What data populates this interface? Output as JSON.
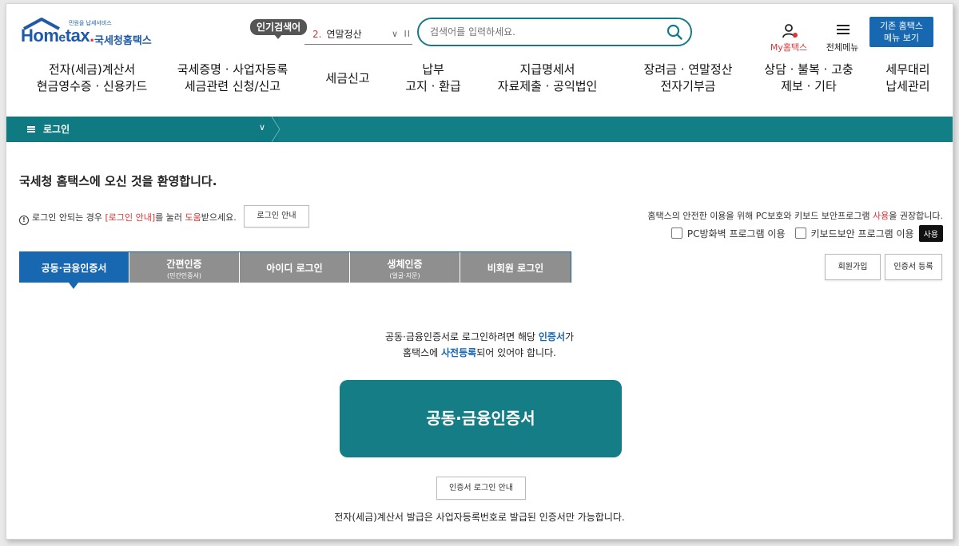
{
  "logo": {
    "tagline": "민원을 납세서비스",
    "word_ho": "Ho",
    "word_m": "m",
    "word_e": "e",
    "word_tax": "tax",
    "word_dot": ".",
    "service_name": "국세청홈택스"
  },
  "header": {
    "popular_badge": "인기검색어",
    "popular_rank": "2.",
    "popular_keyword": "연말정산",
    "search_placeholder": "검색어를 입력하세요.",
    "my_label": "My홈택스",
    "all_menu_label": "전체메뉴",
    "old_menu_line1": "기존 홈택스",
    "old_menu_line2": "메뉴 보기"
  },
  "gnb": [
    {
      "line1": "전자(세금)계산서",
      "line2": "현금영수증 · 신용카드"
    },
    {
      "line1": "국세증명 · 사업자등록",
      "line2": "세금관련 신청/신고"
    },
    {
      "line1": "세금신고",
      "line2": ""
    },
    {
      "line1": "납부",
      "line2": "고지 · 환급"
    },
    {
      "line1": "지급명세서",
      "line2": "자료제출 · 공익법인"
    },
    {
      "line1": "장려금 · 연말정산",
      "line2": "전자기부금"
    },
    {
      "line1": "상담 · 불복 · 고충",
      "line2": "제보 · 기타"
    },
    {
      "line1": "세무대리",
      "line2": "납세관리"
    }
  ],
  "breadcrumb": {
    "label": "로그인"
  },
  "main": {
    "welcome": "국세청 홈택스에 오신 것을 환영합니다.",
    "notice_pre": "로그인 안되는 경우 ",
    "notice_link": "[로그인 안내]",
    "notice_mid": "를 눌러 ",
    "notice_help": "도움",
    "notice_post": "받으세요.",
    "login_guide_button": "로그인 안내",
    "security_pre": "홈택스의 안전한 이용을 위해 PC보호와 키보드 보안프로그램 ",
    "security_use": "사용",
    "security_post": "을 권장합니다.",
    "option_firewall": "PC방화벽 프로그램 이용",
    "option_keyboard": "키보드보안 프로그램 이용",
    "use_button": "사용"
  },
  "tabs": [
    {
      "label": "공동·금융인증서",
      "sub": "",
      "active": true
    },
    {
      "label": "간편인증",
      "sub": "(민간인증서)",
      "active": false
    },
    {
      "label": "아이디 로그인",
      "sub": "",
      "active": false
    },
    {
      "label": "생체인증",
      "sub": "(얼굴·지문)",
      "active": false
    },
    {
      "label": "비회원 로그인",
      "sub": "",
      "active": false
    }
  ],
  "actions": {
    "signup": "회원가입",
    "cert_register": "인증서 등록"
  },
  "cert_panel": {
    "desc1_pre": "공동·금융인증서로 로그인하려면 해당 ",
    "desc1_em": "인증서",
    "desc1_post": "가",
    "desc2_pre": "홈택스에 ",
    "desc2_em": "사전등록",
    "desc2_post": "되어 있어야 합니다.",
    "main_button": "공동·금융인증서",
    "cert_guide_button": "인증서 로그인 안내",
    "footer_note": "전자(세금)계산서 발급은 사업자등록번호로 발급된 인증서만 가능합니다."
  },
  "colors": {
    "teal": "#147d86",
    "blue": "#1767b1",
    "red": "#d33333",
    "tab_gray": "#8f8f8f"
  }
}
